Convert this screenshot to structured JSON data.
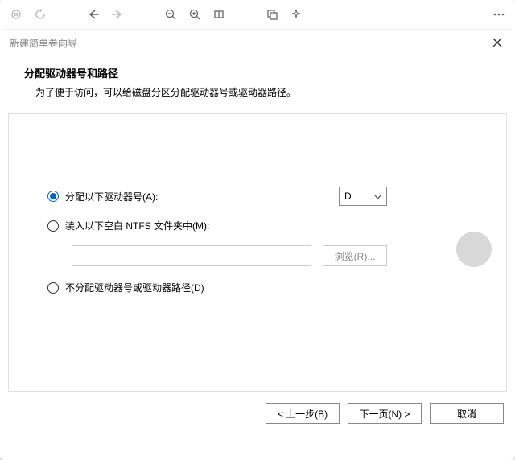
{
  "dialog": {
    "title": "新建简单卷向导"
  },
  "header": {
    "title": "分配驱动器号和路径",
    "subtitle": "为了便于访问，可以给磁盘分区分配驱动器号或驱动器路径。"
  },
  "options": {
    "assign_letter": {
      "label": "分配以下驱动器号(A):",
      "selected_value": "D"
    },
    "mount_ntfs": {
      "label": "装入以下空白 NTFS 文件夹中(M):",
      "path_value": "",
      "browse_label": "浏览(R)..."
    },
    "no_assign": {
      "label": "不分配驱动器号或驱动器路径(D)"
    }
  },
  "footer": {
    "back": "< 上一步(B)",
    "next": "下一页(N) >",
    "cancel": "取消"
  }
}
